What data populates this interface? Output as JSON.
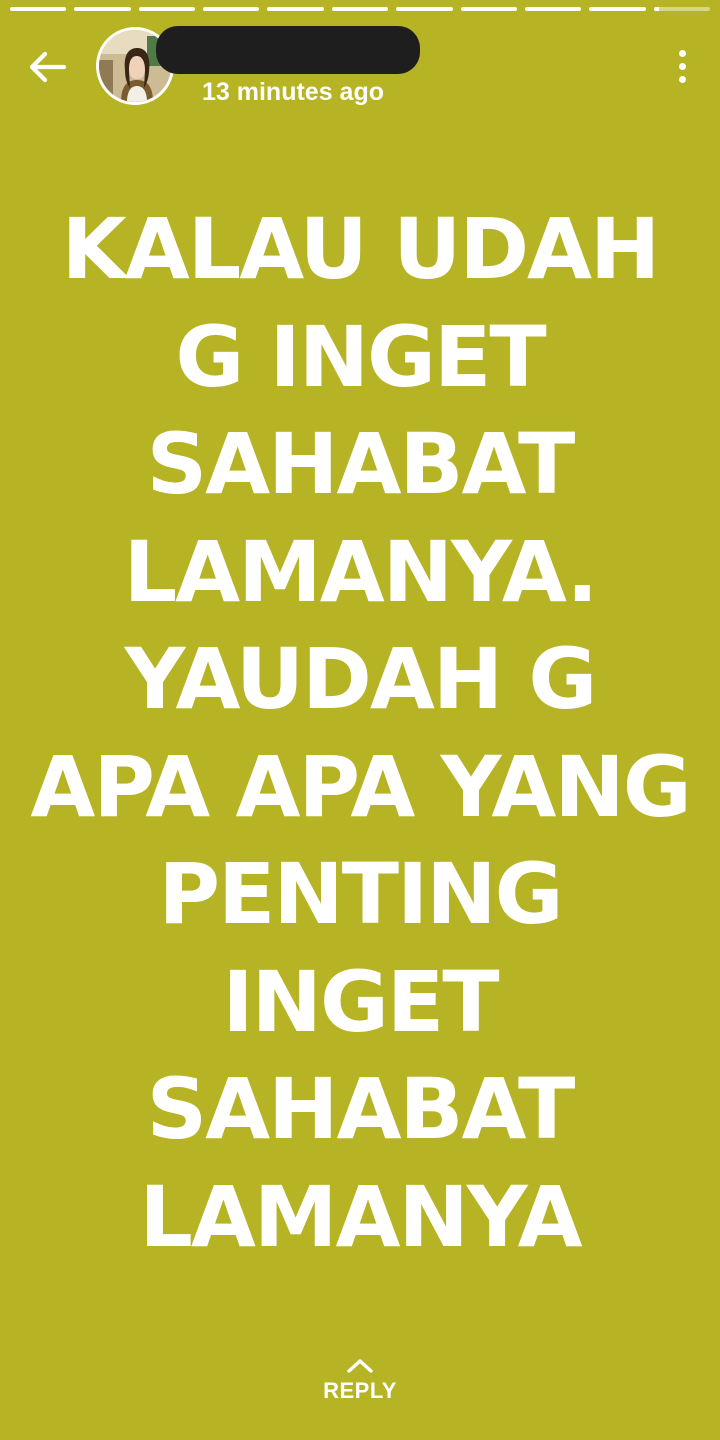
{
  "theme": {
    "background": "#b6b424",
    "text_color": "#ffffff",
    "redaction_color": "#1e1e1e"
  },
  "progress": {
    "total_segments": 11,
    "current_segment": 11,
    "current_fill": 0.1
  },
  "header": {
    "back_icon": "arrow-left-icon",
    "avatar_icon": "profile-avatar",
    "name_redacted": true,
    "timestamp": "13 minutes ago",
    "menu_icon": "more-vertical-icon"
  },
  "story": {
    "lines": [
      "KALAU UDAH",
      "G INGET",
      "SAHABAT",
      "LAMANYA.",
      "YAUDAH G",
      "APA APA YANG",
      "PENTING",
      "INGET",
      "SAHABAT",
      "LAMANYA"
    ]
  },
  "reply": {
    "icon": "chevron-up-icon",
    "label": "REPLY"
  }
}
